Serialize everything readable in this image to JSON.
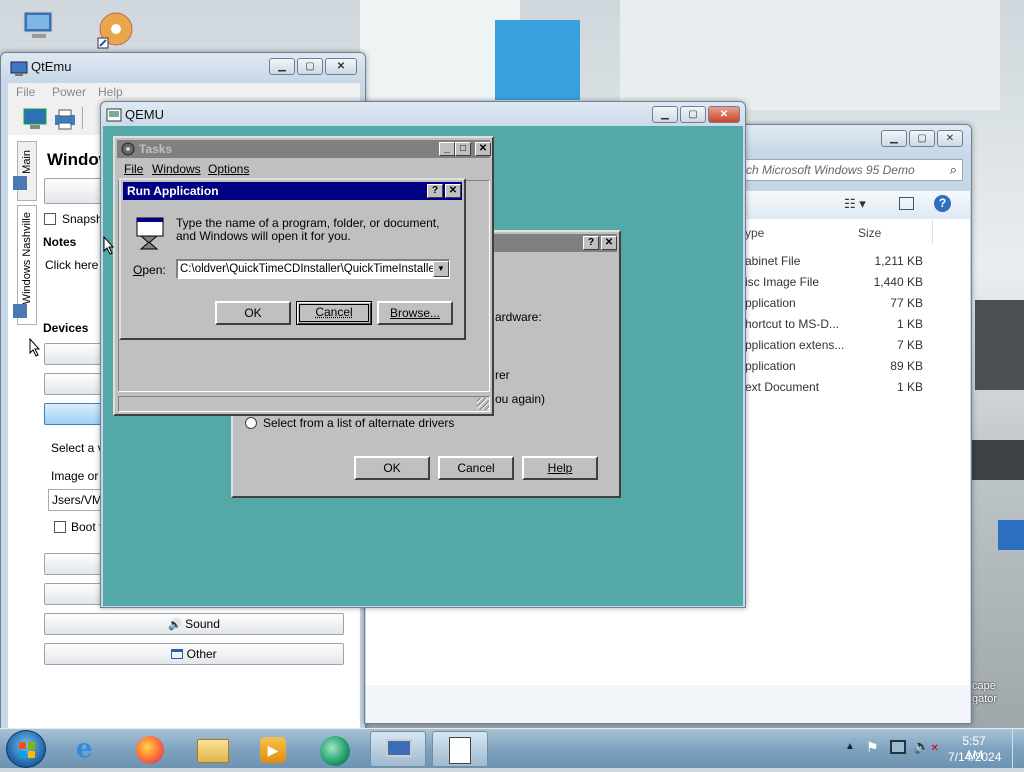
{
  "desktop": {
    "right_labels": [
      "cape",
      "gator"
    ]
  },
  "qtemu": {
    "title": "QtEmu",
    "menu": [
      "File",
      "Power",
      "Help"
    ],
    "tabs": [
      "Main",
      "Windows Nashville"
    ],
    "vm_title": "Window",
    "snapshot_label": "Snapsho",
    "notes_label": "Notes",
    "notes_text": "Click here t",
    "devices_label": "Devices",
    "select_label": "Select a va",
    "image_label": "Image or c",
    "path_value": "Jsers/VM1",
    "boot_label": "Boot fi",
    "sound_button": "Sound",
    "other_button": "Other"
  },
  "qemu": {
    "title": "QEMU"
  },
  "explorer": {
    "search_placeholder": "rch Microsoft Windows 95 Demo",
    "columns": {
      "type": "ype",
      "size": "Size"
    },
    "rows": [
      {
        "type": "abinet File",
        "size": "1,211 KB"
      },
      {
        "type": "isc Image File",
        "size": "1,440 KB"
      },
      {
        "type": "pplication",
        "size": "77 KB"
      },
      {
        "type": "hortcut to MS-D...",
        "size": "1 KB"
      },
      {
        "type": "pplication extens...",
        "size": "7 KB"
      },
      {
        "type": "pplication",
        "size": "89 KB"
      },
      {
        "type": "ext Document",
        "size": "1 KB"
      }
    ]
  },
  "tasks": {
    "title": "Tasks",
    "menu": [
      "File",
      "Windows",
      "Options"
    ]
  },
  "run": {
    "title": "Run Application",
    "message": "Type the name of a program, folder, or document, and Windows will open it for you.",
    "open_label": "Open:",
    "open_value": "C:\\oldver\\QuickTimeCDInstaller\\QuickTimeInstaller.e",
    "ok": "OK",
    "cancel": "Cancel",
    "browse": "Browse..."
  },
  "hwdialog": {
    "text_hardware": "ardware:",
    "text_rer": "rer",
    "text_again": "ou again)",
    "radio_label": "Select from a list of alternate drivers",
    "ok": "OK",
    "cancel": "Cancel",
    "help": "Help"
  },
  "clock": {
    "time": "5:57 AM",
    "date": "7/14/2024"
  },
  "colors": {
    "qemu_screen": "#55a8a8",
    "win95_title": "#000080",
    "win95_face": "#c0c0c0"
  }
}
